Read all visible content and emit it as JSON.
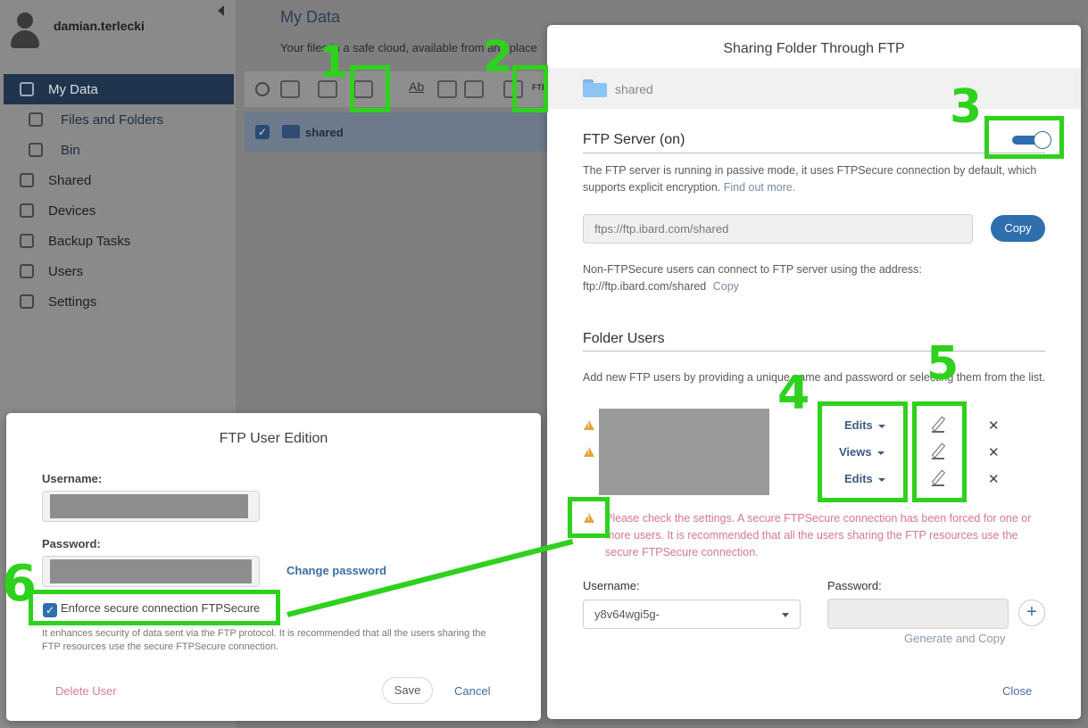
{
  "sidebar": {
    "username": "damian.terlecki",
    "items": [
      {
        "label": "My Data",
        "icon": "my-data-icon",
        "active": true
      },
      {
        "label": "Files and Folders",
        "icon": "files-icon",
        "sub": true
      },
      {
        "label": "Bin",
        "icon": "bin-icon",
        "sub": true
      },
      {
        "label": "Shared",
        "icon": "shared-icon"
      },
      {
        "label": "Devices",
        "icon": "devices-icon"
      },
      {
        "label": "Backup Tasks",
        "icon": "backup-icon"
      },
      {
        "label": "Users",
        "icon": "users-icon"
      },
      {
        "label": "Settings",
        "icon": "settings-icon"
      }
    ]
  },
  "main": {
    "title": "My Data",
    "subtitle": "Your files in a safe cloud, available from any place",
    "toolbar": {
      "rename_label": "Ab",
      "ftp_label": "FTP"
    },
    "file_row": {
      "name": "shared",
      "checked": true
    }
  },
  "ftp_dialog": {
    "title": "Sharing Folder Through FTP",
    "folder_name": "shared",
    "server": {
      "title": "FTP Server (on)",
      "enabled": true,
      "description": "The FTP server is running in passive mode, it uses FTPSecure connection by default, which supports explicit encryption.",
      "find_out_more": "Find out more.",
      "url": "ftps://ftp.ibard.com/shared",
      "copy_label": "Copy",
      "non_secure_text": "Non-FTPSecure users can connect to FTP server using the address:",
      "non_secure_url": "ftp://ftp.ibard.com/shared",
      "non_secure_copy": "Copy"
    },
    "folder_users": {
      "title": "Folder Users",
      "description": "Add new FTP users by providing a unique name and password or selecting them from the list.",
      "users": [
        {
          "permission": "Edits",
          "warning": true
        },
        {
          "permission": "Views",
          "warning": true
        },
        {
          "permission": "Edits",
          "warning": false
        }
      ],
      "warning_text": "Please check the settings. A secure FTPSecure connection has been forced for one or more users. It is recommended that all the users sharing the FTP resources use the secure FTPSecure connection.",
      "username_label": "Username:",
      "username_value": "y8v64wgi5g-",
      "password_label": "Password:",
      "generate_label": "Generate and Copy"
    },
    "close_label": "Close"
  },
  "edit_dialog": {
    "title": "FTP User Edition",
    "username_label": "Username:",
    "password_label": "Password:",
    "change_password": "Change password",
    "enforce_label": "Enforce secure connection FTPSecure",
    "enforce_checked": true,
    "enforce_note": "It enhances security of data sent via the FTP protocol. It is recommended that all the users sharing the FTP resources use the secure FTPSecure connection.",
    "delete_label": "Delete User",
    "save_label": "Save",
    "cancel_label": "Cancel"
  },
  "annotations": {
    "colors": {
      "accent": "#2ed11c"
    },
    "labels": [
      "1",
      "2",
      "3",
      "4",
      "5",
      "6"
    ]
  },
  "colors": {
    "primary": "#2f6fae",
    "nav_active": "#21344d",
    "warning": "#e8a33d",
    "warning_text": "#d9788f"
  }
}
